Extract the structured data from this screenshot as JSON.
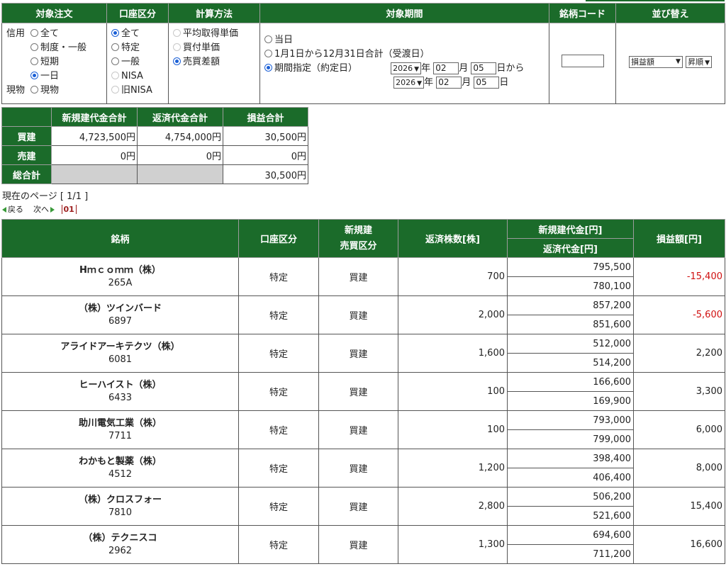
{
  "filter": {
    "headers": [
      "対象注文",
      "口座区分",
      "計算方法",
      "対象期間",
      "銘柄コード",
      "並び替え"
    ],
    "order_target": {
      "shinyo_label": "信用",
      "genbutsu_label": "現物",
      "shinyo_options": [
        {
          "label": "全て",
          "selected": false
        },
        {
          "label": "制度・一般",
          "selected": false
        },
        {
          "label": "短期",
          "selected": false
        },
        {
          "label": "一日",
          "selected": true
        }
      ],
      "genbutsu_options": [
        {
          "label": "現物",
          "selected": false
        }
      ]
    },
    "account_type": [
      {
        "label": "全て",
        "selected": true,
        "disabled": false
      },
      {
        "label": "特定",
        "selected": false,
        "disabled": false
      },
      {
        "label": "一般",
        "selected": false,
        "disabled": false
      },
      {
        "label": "NISA",
        "selected": false,
        "disabled": true
      },
      {
        "label": "旧NISA",
        "selected": false,
        "disabled": true
      }
    ],
    "calc_method": [
      {
        "label": "平均取得単価",
        "selected": false,
        "disabled": true
      },
      {
        "label": "買付単価",
        "selected": false,
        "disabled": true
      },
      {
        "label": "売買差額",
        "selected": true,
        "disabled": false
      }
    ],
    "period": {
      "options": [
        {
          "label": "当日",
          "selected": false
        },
        {
          "label": "1月1日から12月31日合計（受渡日）",
          "selected": false
        },
        {
          "label": "期間指定（約定日）",
          "selected": true
        }
      ],
      "from": {
        "year": "2026",
        "month": "02",
        "day": "05",
        "suffix": "日から"
      },
      "to": {
        "year": "2026",
        "month": "02",
        "day": "05",
        "suffix": "日"
      },
      "year_unit": "年",
      "month_unit": "月"
    },
    "stock_code_value": "",
    "sort": {
      "field": "損益額",
      "order": "昇順"
    }
  },
  "summary": {
    "headers": [
      "",
      "新規建代金合計",
      "返済代金合計",
      "損益合計"
    ],
    "rows": [
      {
        "label": "買建",
        "open": "4,723,500円",
        "close": "4,754,000円",
        "pl": "30,500円"
      },
      {
        "label": "売建",
        "open": "0円",
        "close": "0円",
        "pl": "0円"
      },
      {
        "label": "総合計",
        "open": "",
        "close": "",
        "pl": "30,500円"
      }
    ]
  },
  "pagination": {
    "current_page": "現在のページ [ 1/1 ]",
    "back": "戻る",
    "next": "次へ",
    "page": "01"
  },
  "table": {
    "headers": {
      "stock": "銘柄",
      "account": "口座区分",
      "trade_type": "新規建\n売買区分",
      "qty": "返済株数[株]",
      "open_amount": "新規建代金[円]",
      "close_amount": "返済代金[円]",
      "pl": "損益額[円]"
    },
    "rows": [
      {
        "name": "Hｍｃｏｍｍ（株）",
        "code": "265A",
        "account": "特定",
        "type": "買建",
        "qty": "700",
        "open": "795,500",
        "close": "780,100",
        "pl": "-15,400",
        "negative": true
      },
      {
        "name": "（株）ツインバード",
        "code": "6897",
        "account": "特定",
        "type": "買建",
        "qty": "2,000",
        "open": "857,200",
        "close": "851,600",
        "pl": "-5,600",
        "negative": true
      },
      {
        "name": "アライドアーキテクツ（株）",
        "code": "6081",
        "account": "特定",
        "type": "買建",
        "qty": "1,600",
        "open": "512,000",
        "close": "514,200",
        "pl": "2,200",
        "negative": false
      },
      {
        "name": "ヒーハイスト（株）",
        "code": "6433",
        "account": "特定",
        "type": "買建",
        "qty": "100",
        "open": "166,600",
        "close": "169,900",
        "pl": "3,300",
        "negative": false
      },
      {
        "name": "助川電気工業（株）",
        "code": "7711",
        "account": "特定",
        "type": "買建",
        "qty": "100",
        "open": "793,000",
        "close": "799,000",
        "pl": "6,000",
        "negative": false
      },
      {
        "name": "わかもと製薬（株）",
        "code": "4512",
        "account": "特定",
        "type": "買建",
        "qty": "1,200",
        "open": "398,400",
        "close": "406,400",
        "pl": "8,000",
        "negative": false
      },
      {
        "name": "（株）クロスフォー",
        "code": "7810",
        "account": "特定",
        "type": "買建",
        "qty": "2,800",
        "open": "506,200",
        "close": "521,600",
        "pl": "15,400",
        "negative": false
      },
      {
        "name": "（株）テクニスコ",
        "code": "2962",
        "account": "特定",
        "type": "買建",
        "qty": "1,300",
        "open": "694,600",
        "close": "711,200",
        "pl": "16,600",
        "negative": false
      }
    ]
  },
  "colors": {
    "header_green": "#1b6b2a",
    "negative_red": "#d01010",
    "total_gray": "#d0d0d0"
  }
}
